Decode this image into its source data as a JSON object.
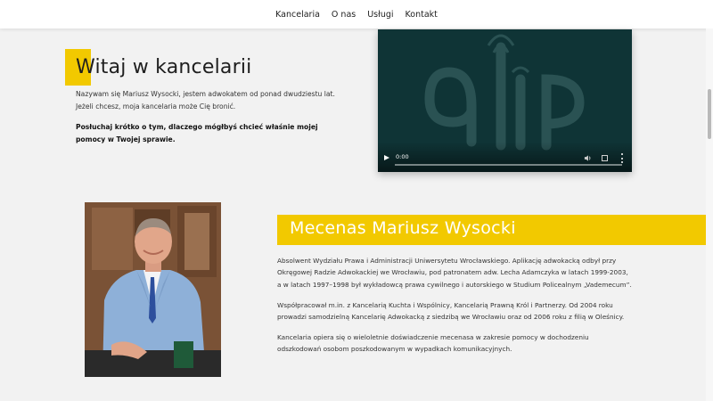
{
  "nav": {
    "items": [
      {
        "label": "Kancelaria"
      },
      {
        "label": "O nas"
      },
      {
        "label": "Usługi"
      },
      {
        "label": "Kontakt"
      }
    ]
  },
  "hero": {
    "title": "Witaj w kancelarii",
    "intro": "Nazywam się Mariusz Wysocki, jestem adwokatem od ponad dwudziestu lat. Jeżeli chcesz, moja kancelaria może Cię bronić.",
    "cta": "Posłuchaj krótko o tym, dlaczego mógłbyś chcieć właśnie mojej pomocy w Twojej sprawie."
  },
  "video": {
    "time": "0:00",
    "progress": 0,
    "logo_icon": "adwokatura-logo",
    "background": "#0f3436"
  },
  "profile": {
    "name": "Mecenas Mariusz Wysocki",
    "paragraphs": [
      "Absolwent Wydziału Prawa i Administracji Uniwersytetu Wrocławskiego. Aplikację adwokacką odbył przy Okręgowej Radzie Adwokackiej we Wrocławiu, pod patronatem adw. Lecha Adamczyka w latach 1999-2003, a w latach 1997–1998 był wykładowcą prawa cywilnego i autorskiego w Studium Policealnym „Vademecum”.",
      "Współpracował m.in. z Kancelarią Kuchta i Wspólnicy, Kancelarią Prawną Król i Partnerzy. Od 2004 roku prowadzi samodzielną Kancelarię Adwokacką z siedzibą we Wrocławiu oraz od 2006 roku z filią w Oleśnicy.",
      "Kancelaria opiera się o wieloletnie doświadczenie mecenasa w zakresie pomocy w dochodzeniu odszkodowań osobom poszkodowanym w wypadkach komunikacyjnych."
    ]
  },
  "colors": {
    "accent": "#f2c900",
    "page_background": "#f2f2f2",
    "text": "#333333"
  }
}
